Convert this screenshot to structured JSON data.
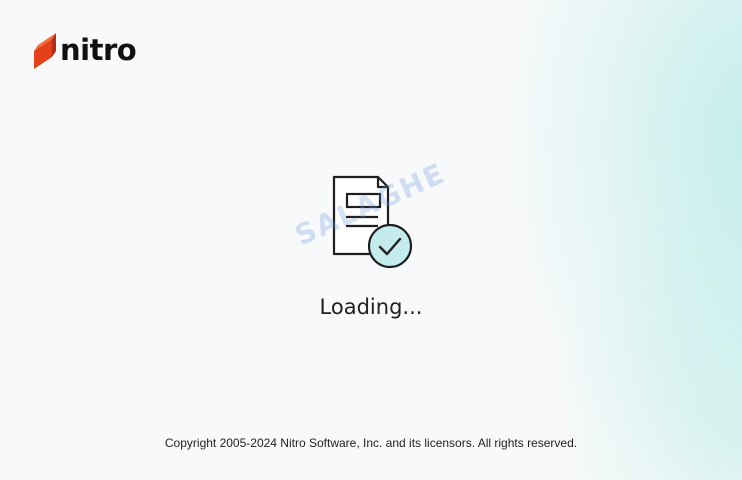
{
  "app": {
    "name": "nitro",
    "brand_color": "#e4411b",
    "logo_icon": "nitro-n-logo-icon"
  },
  "splash": {
    "status_icon": "document-check-icon",
    "status_text": "Loading...",
    "watermark_text": "SALAGHE"
  },
  "footer": {
    "copyright": "Copyright 2005-2024 Nitro Software, Inc. and its licensors. All rights reserved."
  },
  "colors": {
    "background": "#f8f9fa",
    "glow_accent": "#b0eae4",
    "check_circle_fill": "#c5ecec",
    "text_primary": "#222222"
  }
}
